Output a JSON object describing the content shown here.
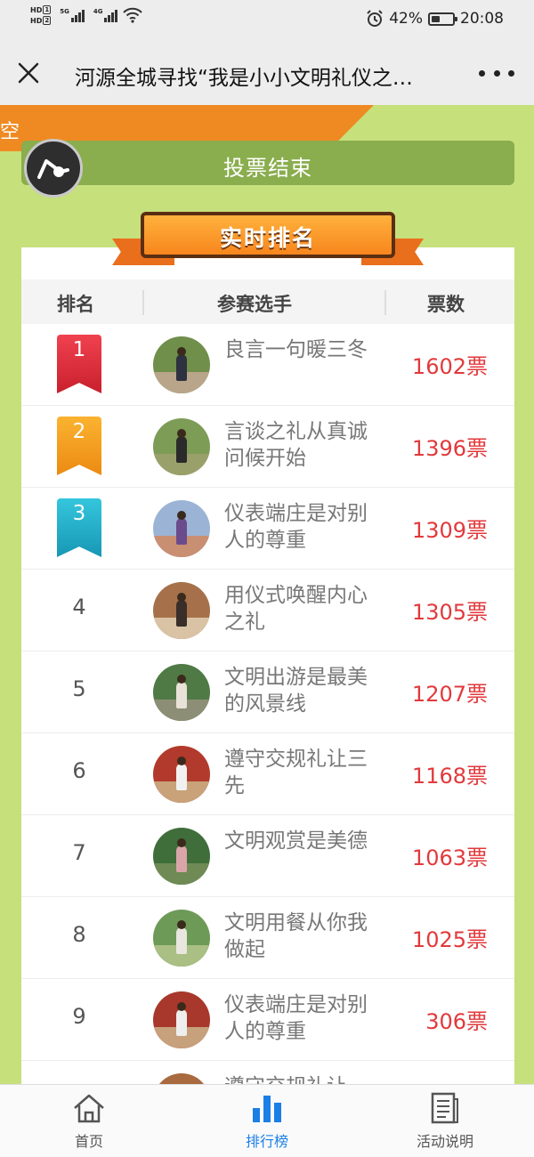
{
  "status_bar": {
    "hd1": "HD",
    "hd1_sub": "1",
    "hd2": "HD",
    "hd2_sub": "2",
    "net1": "5G",
    "net2": "4G",
    "battery_percent": "42%",
    "battery_level": 0.42,
    "time": "20:08"
  },
  "nav": {
    "title": "河源全城寻找“我是小小文明礼仪之…"
  },
  "banner": {
    "orange_text": "空",
    "vote_status": "投票结束"
  },
  "ranking": {
    "ribbon_title": "实时排名",
    "headers": {
      "rank": "排名",
      "player": "参赛选手",
      "votes": "票数"
    },
    "rows": [
      {
        "rank": "1",
        "title": "良言一句暖三冬",
        "votes": "1602票"
      },
      {
        "rank": "2",
        "title": "言谈之礼从真诚问候开始",
        "votes": "1396票"
      },
      {
        "rank": "3",
        "title": "仪表端庄是对别人的尊重",
        "votes": "1309票"
      },
      {
        "rank": "4",
        "title": "用仪式唤醒内心之礼",
        "votes": "1305票"
      },
      {
        "rank": "5",
        "title": "文明出游是最美的风景线",
        "votes": "1207票"
      },
      {
        "rank": "6",
        "title": "遵守交规礼让三先",
        "votes": "1168票"
      },
      {
        "rank": "7",
        "title": "文明观赏是美德",
        "votes": "1063票"
      },
      {
        "rank": "8",
        "title": "文明用餐从你我做起",
        "votes": "1025票"
      },
      {
        "rank": "9",
        "title": "仪表端庄是对别人的尊重",
        "votes": "306票"
      },
      {
        "rank": "",
        "title": "遵守交规礼让",
        "votes": ""
      }
    ]
  },
  "tabs": {
    "home": "首页",
    "rank": "排行榜",
    "description": "活动说明"
  },
  "colors": {
    "background_green": "#c6e07c",
    "vote_red": "#e2393c",
    "active_tab_blue": "#1b7fe6",
    "orange": "#ef8a22"
  }
}
